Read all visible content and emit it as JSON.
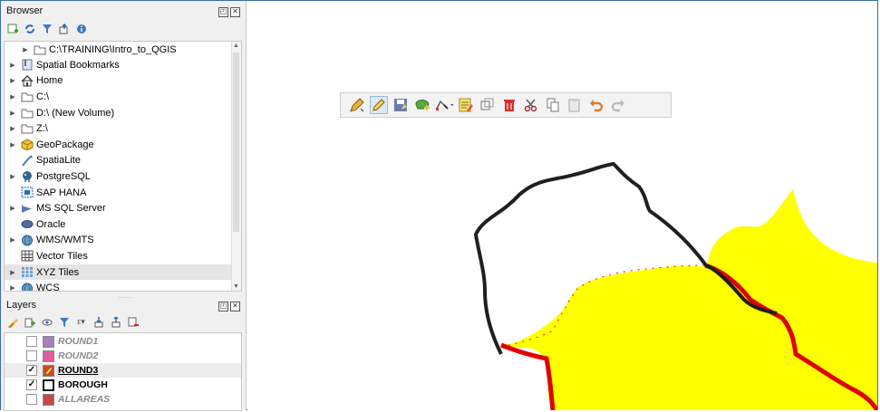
{
  "browser": {
    "title": "Browser",
    "toolbar_icons": [
      "add-layer-icon",
      "refresh-icon",
      "filter-icon",
      "collapse-icon",
      "info-icon"
    ],
    "items": [
      {
        "label": "C:\\TRAINING\\Intro_to_QGIS",
        "icon": "folder-icon",
        "indent": 1
      },
      {
        "label": "Spatial Bookmarks",
        "icon": "bookmarks-icon",
        "indent": 0
      },
      {
        "label": "Home",
        "icon": "home-icon",
        "indent": 0
      },
      {
        "label": "C:\\",
        "icon": "folder-icon",
        "indent": 0
      },
      {
        "label": "D:\\ (New Volume)",
        "icon": "folder-icon",
        "indent": 0
      },
      {
        "label": "Z:\\",
        "icon": "folder-icon",
        "indent": 0
      },
      {
        "label": "GeoPackage",
        "icon": "geopackage-icon",
        "indent": 0
      },
      {
        "label": "SpatiaLite",
        "icon": "spatialite-icon",
        "indent": 0
      },
      {
        "label": "PostgreSQL",
        "icon": "postgresql-icon",
        "indent": 0
      },
      {
        "label": "SAP HANA",
        "icon": "hana-icon",
        "indent": 0
      },
      {
        "label": "MS SQL Server",
        "icon": "mssql-icon",
        "indent": 0
      },
      {
        "label": "Oracle",
        "icon": "oracle-icon",
        "indent": 0
      },
      {
        "label": "WMS/WMTS",
        "icon": "globe-icon",
        "indent": 0
      },
      {
        "label": "Vector Tiles",
        "icon": "grid-icon",
        "indent": 0
      },
      {
        "label": "XYZ Tiles",
        "icon": "tiles-icon",
        "indent": 0
      },
      {
        "label": "WCS",
        "icon": "globe-icon",
        "indent": 0
      }
    ]
  },
  "layers": {
    "title": "Layers",
    "items": [
      {
        "name": "ROUND1",
        "checked": false,
        "color": "#a77fc0",
        "visible": false
      },
      {
        "name": "ROUND2",
        "checked": false,
        "color": "#e0609a",
        "visible": false
      },
      {
        "name": "ROUND3",
        "checked": true,
        "color": "#d2461f",
        "visible": true,
        "underline": true
      },
      {
        "name": "BOROUGH",
        "checked": true,
        "color": "#ffffff",
        "visible": true
      },
      {
        "name": "ALLAREAS",
        "checked": false,
        "color": "#c54949",
        "visible": false
      }
    ]
  },
  "digitize_toolbar": {
    "icons": [
      "edits-icon",
      "toggle-editing-icon",
      "save-edits-icon",
      "add-polygon-icon",
      "vertex-tool-icon",
      "modify-attributes-icon",
      "select-icon",
      "delete-icon",
      "cut-icon",
      "copy-icon",
      "paste-icon",
      "undo-icon",
      "redo-icon"
    ]
  },
  "colors": {
    "fill": "#ffff00",
    "edit_vertex": "#ff0000",
    "boundary": "#1f1f1f"
  }
}
